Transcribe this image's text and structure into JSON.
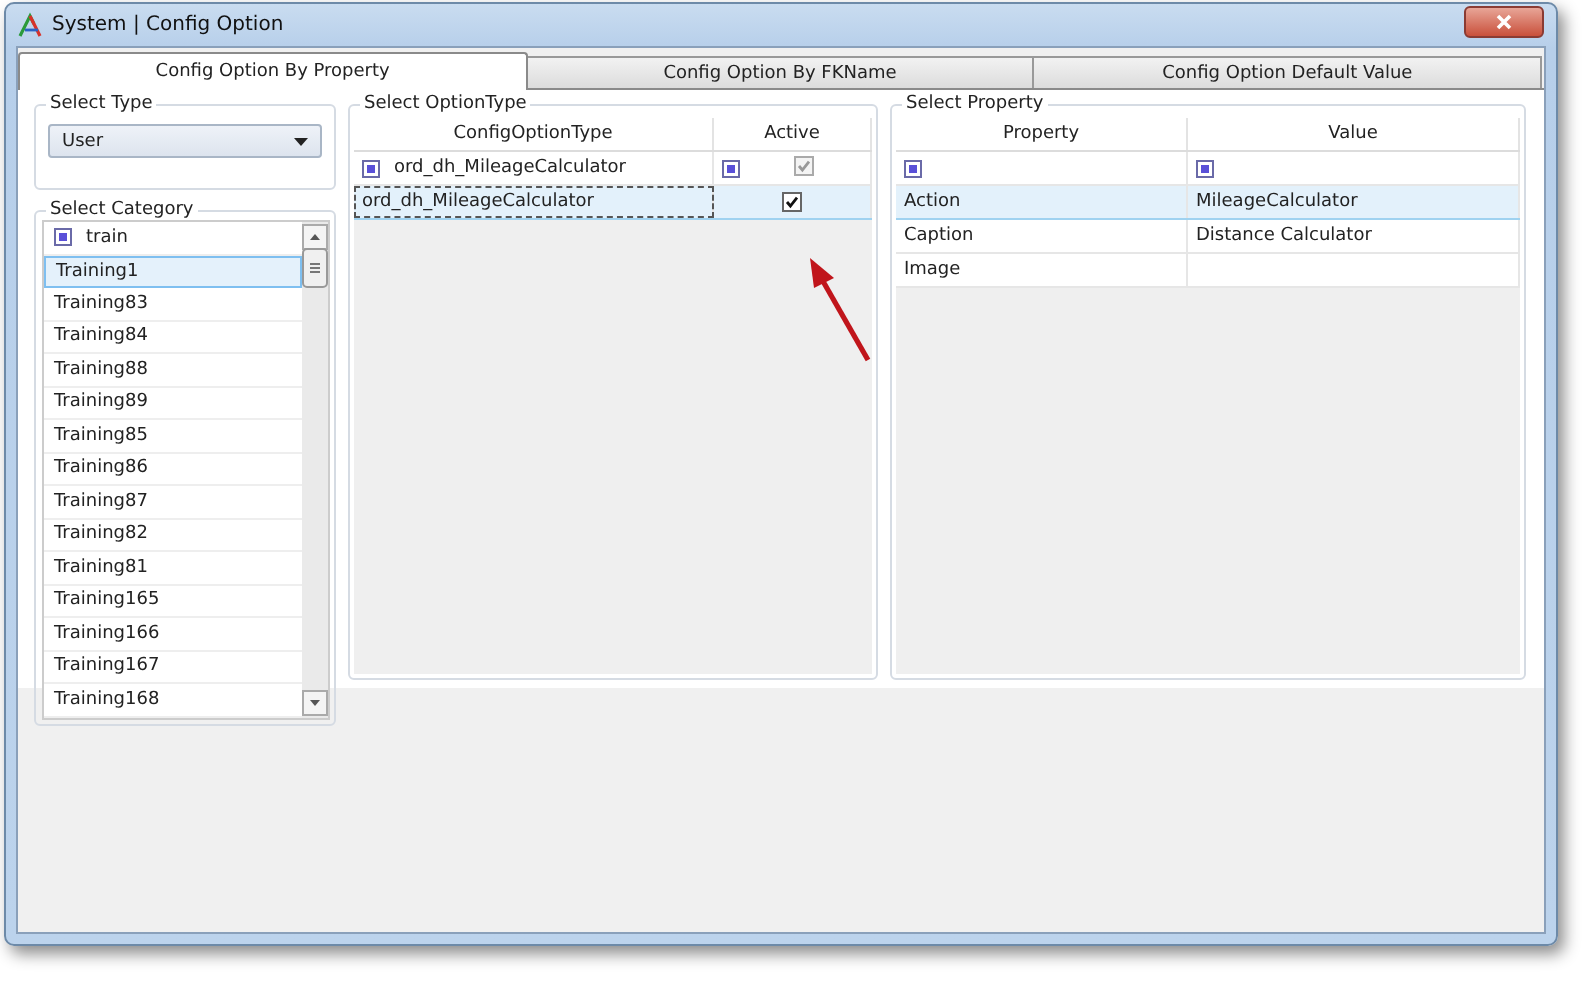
{
  "window": {
    "title": "System | Config Option"
  },
  "tabs": [
    {
      "label": "Config Option By Property",
      "selected": true
    },
    {
      "label": "Config Option By FKName",
      "selected": false
    },
    {
      "label": "Config Option Default Value",
      "selected": false
    }
  ],
  "select_type": {
    "label": "Select Type",
    "value": "User"
  },
  "select_category": {
    "label": "Select Category",
    "filter": "train",
    "items": [
      {
        "label": "Training1",
        "selected": true
      },
      {
        "label": "Training83",
        "selected": false
      },
      {
        "label": "Training84",
        "selected": false
      },
      {
        "label": "Training88",
        "selected": false
      },
      {
        "label": "Training89",
        "selected": false
      },
      {
        "label": "Training85",
        "selected": false
      },
      {
        "label": "Training86",
        "selected": false
      },
      {
        "label": "Training87",
        "selected": false
      },
      {
        "label": "Training82",
        "selected": false
      },
      {
        "label": "Training81",
        "selected": false
      },
      {
        "label": "Training165",
        "selected": false
      },
      {
        "label": "Training166",
        "selected": false
      },
      {
        "label": "Training167",
        "selected": false
      },
      {
        "label": "Training168",
        "selected": false
      }
    ]
  },
  "select_option_type": {
    "label": "Select OptionType",
    "columns": [
      "ConfigOptionType",
      "Active"
    ],
    "filter_row": {
      "text": "ord_dh_MileageCalculator",
      "active_checked": true
    },
    "rows": [
      {
        "config_option_type": "ord_dh_MileageCalculator",
        "active": true,
        "selected": true
      }
    ]
  },
  "select_property": {
    "label": "Select Property",
    "columns": [
      "Property",
      "Value"
    ],
    "rows": [
      {
        "property": "Action",
        "value": "MileageCalculator",
        "selected": true
      },
      {
        "property": "Caption",
        "value": "Distance Calculator",
        "selected": false
      },
      {
        "property": "Image",
        "value": "",
        "selected": false
      }
    ]
  }
}
